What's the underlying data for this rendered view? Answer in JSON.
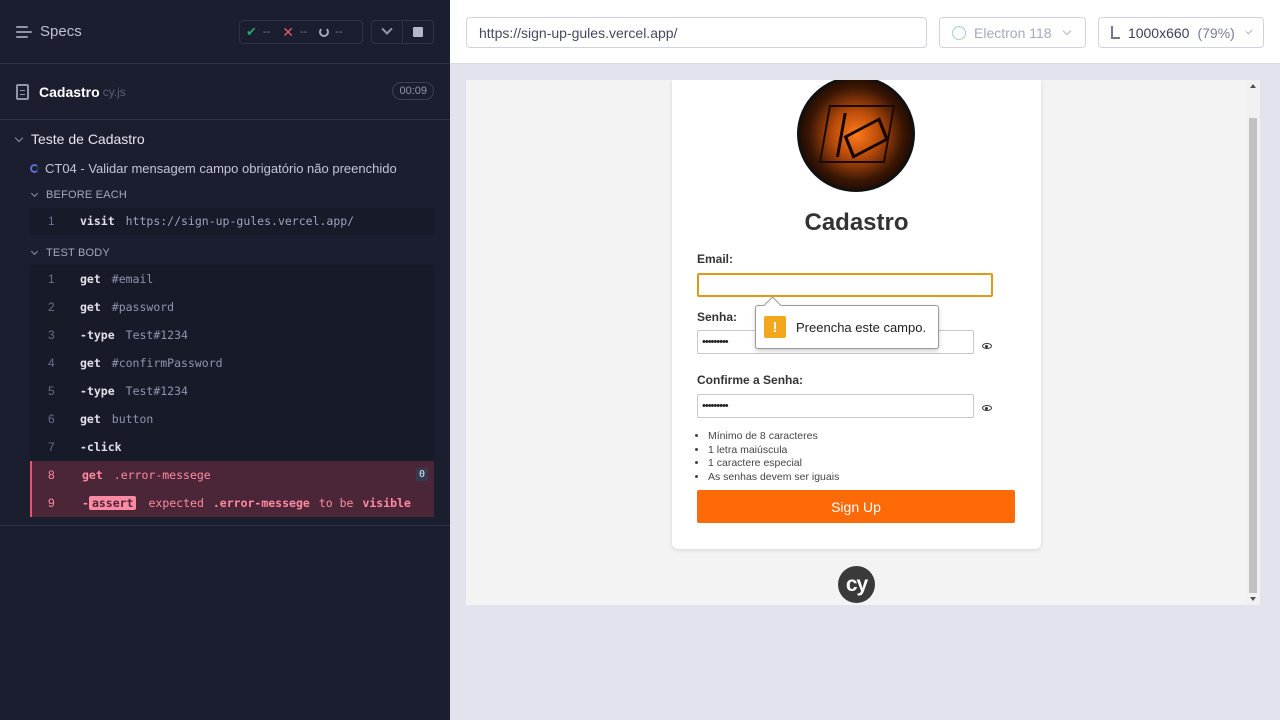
{
  "reporter": {
    "specs_label": "Specs",
    "stats": {
      "passed": "--",
      "failed": "--",
      "pending": "--"
    },
    "spec": {
      "name": "Cadastro",
      "ext": "cy.js",
      "duration": "00:09"
    },
    "suite_title": "Teste de Cadastro",
    "test_title": "CT04 - Validar mensagem campo obrigatório não preenchido",
    "before_each": {
      "label": "BEFORE EACH",
      "commands": [
        {
          "num": "1",
          "name": "visit",
          "msg": "https://sign-up-gules.vercel.app/"
        }
      ]
    },
    "test_body": {
      "label": "TEST BODY",
      "commands": [
        {
          "num": "1",
          "name": "get",
          "msg": "#email"
        },
        {
          "num": "2",
          "name": "get",
          "msg": "#password"
        },
        {
          "num": "3",
          "name": "type",
          "msg": "Test#1234"
        },
        {
          "num": "4",
          "name": "get",
          "msg": "#confirmPassword"
        },
        {
          "num": "5",
          "name": "type",
          "msg": "Test#1234"
        },
        {
          "num": "6",
          "name": "get",
          "msg": "button"
        },
        {
          "num": "7",
          "name": "click",
          "msg": ""
        },
        {
          "num": "8",
          "name": "get",
          "msg": ".error-messege",
          "badge": "0"
        },
        {
          "num": "9",
          "tag": "assert",
          "w1": "expected",
          "selector": ".error-messege",
          "w2": "to be",
          "w3": "visible"
        }
      ]
    }
  },
  "aut": {
    "url": "https://sign-up-gules.vercel.app/",
    "browser": "Electron 118",
    "viewport_size": "1000x660",
    "viewport_scale": "(79%)"
  },
  "form": {
    "title": "Cadastro",
    "email_label": "Email:",
    "password_label": "Senha:",
    "password_value": "•••••••••",
    "confirm_label": "Confirme a Senha:",
    "confirm_value": "•••••••••",
    "tooltip": "Preencha este campo.",
    "rules": [
      "Mínimo de 8 caracteres",
      "1 letra maiúscula",
      "1 caractere especial",
      "As senhas devem ser iguais"
    ],
    "submit_label": "Sign Up"
  },
  "footer_logo": "cy",
  "colors": {
    "accent": "#ff6a08",
    "error": "#ff8aa1",
    "pass": "#1fa971",
    "fail": "#e45770"
  }
}
